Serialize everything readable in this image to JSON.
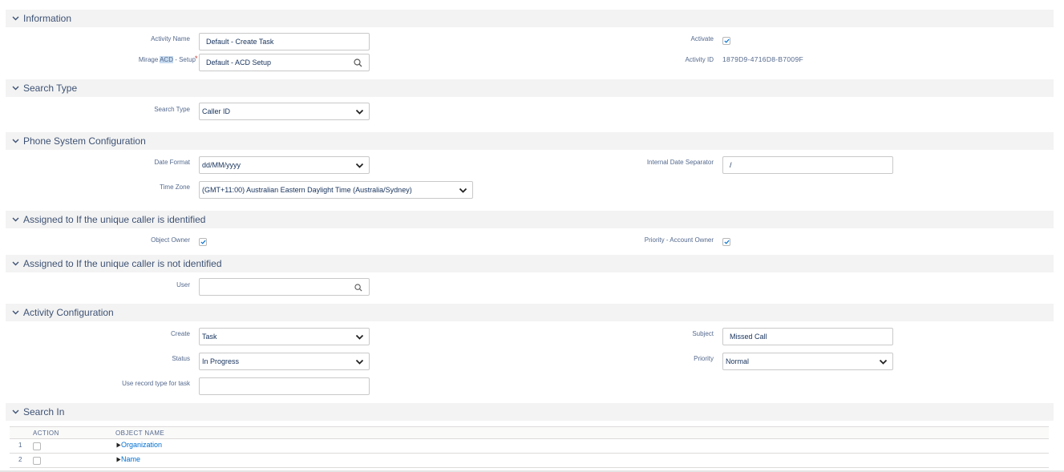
{
  "sections": {
    "information": "Information",
    "search_type": "Search Type",
    "phone_system": "Phone System Configuration",
    "assigned_identified": "Assigned to If the unique caller is identified",
    "assigned_not_identified": "Assigned to If the unique caller is not identified",
    "activity_config": "Activity Configuration",
    "search_in": "Search In"
  },
  "information": {
    "activity_name_label": "Activity Name",
    "activity_name_value": "Default - Create Task",
    "mirage_label_prefix": "Mirage ",
    "mirage_label_highlight": "ACD",
    "mirage_label_suffix": " - Setup",
    "required_mark": "*",
    "mirage_value": "Default - ACD Setup",
    "activate_label": "Activate",
    "activate_checked": true,
    "activity_id_label": "Activity ID",
    "activity_id_value": "1879D9-4716D8-B7009F"
  },
  "search_type": {
    "label": "Search Type",
    "value": "Caller ID"
  },
  "phone_system": {
    "date_format_label": "Date Format",
    "date_format_value": "dd/MM/yyyy",
    "separator_label": "Internal Date Separator",
    "separator_value": "/",
    "time_zone_label": "Time Zone",
    "time_zone_value": "(GMT+11:00) Australian Eastern Daylight Time (Australia/Sydney)"
  },
  "assigned_identified": {
    "object_owner_label": "Object Owner",
    "object_owner_checked": true,
    "priority_owner_label": "Priority - Account Owner",
    "priority_owner_checked": true
  },
  "assigned_not_identified": {
    "user_label": "User",
    "user_value": ""
  },
  "activity_config": {
    "create_label": "Create",
    "create_value": "Task",
    "subject_label": "Subject",
    "subject_value": "Missed Call",
    "status_label": "Status",
    "status_value": "In Progress",
    "priority_label": "Priority",
    "priority_value": "Normal",
    "record_type_label": "Use record type for task",
    "record_type_value": ""
  },
  "search_in": {
    "columns": [
      "ACTION",
      "OBJECT NAME"
    ],
    "rows": [
      {
        "num": "1",
        "name": "Organization"
      },
      {
        "num": "2",
        "name": "Name"
      }
    ]
  },
  "icons": {
    "chevron": "chevron-down-icon",
    "search": "search-icon",
    "check": "check-icon",
    "caret": "caret-down-icon",
    "expand": "triangle-right-icon"
  },
  "colors": {
    "section_bg": "#f3f3f3",
    "section_title": "#3e5274",
    "label": "#54698d",
    "link": "#0070d2",
    "required": "#c23934"
  }
}
